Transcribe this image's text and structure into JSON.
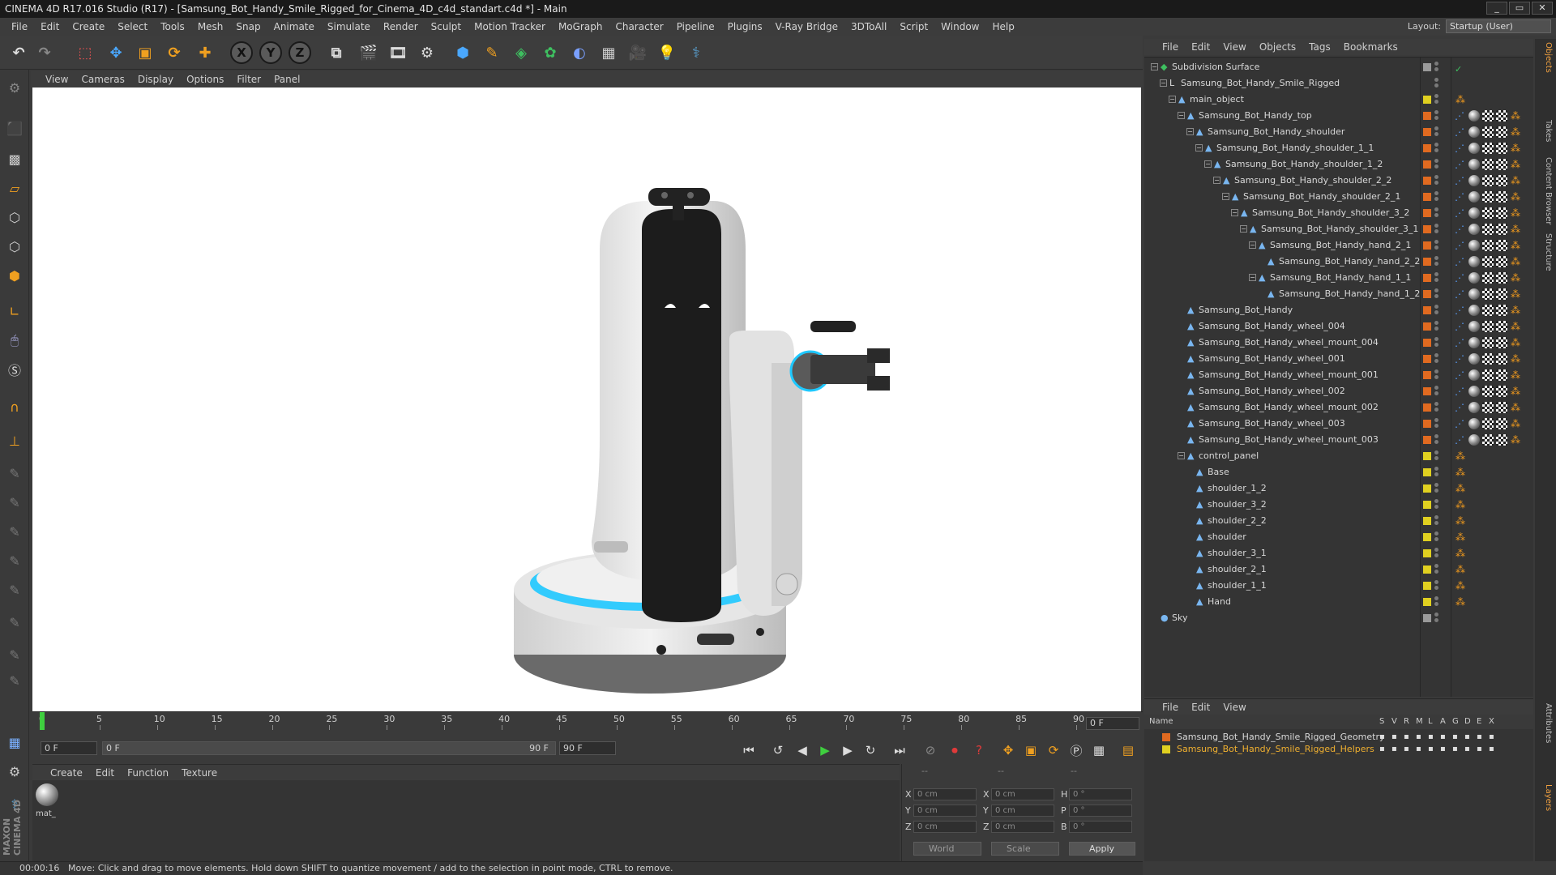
{
  "window": {
    "title": "CINEMA 4D R17.016 Studio (R17) - [Samsung_Bot_Handy_Smile_Rigged_for_Cinema_4D_c4d_standart.c4d *] - Main",
    "controls": [
      "_",
      "▭",
      "✕"
    ]
  },
  "menubar": {
    "items": [
      "File",
      "Edit",
      "Create",
      "Select",
      "Tools",
      "Mesh",
      "Snap",
      "Animate",
      "Simulate",
      "Render",
      "Sculpt",
      "Motion Tracker",
      "MoGraph",
      "Character",
      "Pipeline",
      "Plugins",
      "V-Ray Bridge",
      "3DToAll",
      "Script",
      "Window",
      "Help"
    ],
    "layout_label": "Layout:",
    "layout_value": "Startup (User)"
  },
  "toolbar": {
    "axis_x": "X",
    "axis_y": "Y",
    "axis_z": "Z"
  },
  "viewport": {
    "menu": [
      "View",
      "Cameras",
      "Display",
      "Options",
      "Filter",
      "Panel"
    ]
  },
  "timeline": {
    "ticks": [
      "0",
      "5",
      "10",
      "15",
      "20",
      "25",
      "30",
      "35",
      "40",
      "45",
      "50",
      "55",
      "60",
      "65",
      "70",
      "75",
      "80",
      "85",
      "90"
    ],
    "current_frame": "0 F"
  },
  "transport": {
    "start_frame": "0 F",
    "range_start": "0 F",
    "range_end": "90 F",
    "end_frame": "90 F"
  },
  "material_manager": {
    "menu": [
      "Create",
      "Edit",
      "Function",
      "Texture"
    ],
    "materials": [
      {
        "name": "mat_"
      }
    ]
  },
  "coordinates": {
    "header": [
      "--",
      "--",
      "--"
    ],
    "rows": [
      {
        "a": "X",
        "v1": "0 cm",
        "b": "X",
        "v2": "0 cm",
        "c": "H",
        "v3": "0 °"
      },
      {
        "a": "Y",
        "v1": "0 cm",
        "b": "Y",
        "v2": "0 cm",
        "c": "P",
        "v3": "0 °"
      },
      {
        "a": "Z",
        "v1": "0 cm",
        "b": "Z",
        "v2": "0 cm",
        "c": "B",
        "v3": "0 °"
      }
    ],
    "space": "World",
    "mode": "Scale",
    "apply": "Apply"
  },
  "statusbar": {
    "time": "00:00:16",
    "message": "Move: Click and drag to move elements. Hold down SHIFT to quantize movement / add to the selection in point mode, CTRL to remove."
  },
  "object_manager": {
    "menu": [
      "File",
      "Edit",
      "View",
      "Objects",
      "Tags",
      "Bookmarks"
    ],
    "rows": [
      {
        "name": "Subdivision Surface",
        "depth": 0,
        "color": "#9a9a9a",
        "kind": "subd"
      },
      {
        "name": "Samsung_Bot_Handy_Smile_Rigged",
        "depth": 1,
        "color": "",
        "kind": "null"
      },
      {
        "name": "main_object",
        "depth": 2,
        "color": "#e0d020",
        "kind": "bone"
      },
      {
        "name": "Samsung_Bot_Handy_top",
        "depth": 3,
        "color": "#e06a20",
        "kind": "bone"
      },
      {
        "name": "Samsung_Bot_Handy_shoulder",
        "depth": 4,
        "color": "#e06a20",
        "kind": "bone"
      },
      {
        "name": "Samsung_Bot_Handy_shoulder_1_1",
        "depth": 5,
        "color": "#e06a20",
        "kind": "bone"
      },
      {
        "name": "Samsung_Bot_Handy_shoulder_1_2",
        "depth": 6,
        "color": "#e06a20",
        "kind": "bone"
      },
      {
        "name": "Samsung_Bot_Handy_shoulder_2_2",
        "depth": 7,
        "color": "#e06a20",
        "kind": "bone"
      },
      {
        "name": "Samsung_Bot_Handy_shoulder_2_1",
        "depth": 8,
        "color": "#e06a20",
        "kind": "bone"
      },
      {
        "name": "Samsung_Bot_Handy_shoulder_3_2",
        "depth": 9,
        "color": "#e06a20",
        "kind": "bone"
      },
      {
        "name": "Samsung_Bot_Handy_shoulder_3_1",
        "depth": 10,
        "color": "#e06a20",
        "kind": "bone"
      },
      {
        "name": "Samsung_Bot_Handy_hand_2_1",
        "depth": 11,
        "color": "#e06a20",
        "kind": "bone"
      },
      {
        "name": "Samsung_Bot_Handy_hand_2_2",
        "depth": 12,
        "color": "#e06a20",
        "kind": "bone"
      },
      {
        "name": "Samsung_Bot_Handy_hand_1_1",
        "depth": 11,
        "color": "#e06a20",
        "kind": "bone"
      },
      {
        "name": "Samsung_Bot_Handy_hand_1_2",
        "depth": 12,
        "color": "#e06a20",
        "kind": "bone"
      },
      {
        "name": "Samsung_Bot_Handy",
        "depth": 3,
        "color": "#e06a20",
        "kind": "bone"
      },
      {
        "name": "Samsung_Bot_Handy_wheel_004",
        "depth": 3,
        "color": "#e06a20",
        "kind": "bone"
      },
      {
        "name": "Samsung_Bot_Handy_wheel_mount_004",
        "depth": 3,
        "color": "#e06a20",
        "kind": "bone"
      },
      {
        "name": "Samsung_Bot_Handy_wheel_001",
        "depth": 3,
        "color": "#e06a20",
        "kind": "bone"
      },
      {
        "name": "Samsung_Bot_Handy_wheel_mount_001",
        "depth": 3,
        "color": "#e06a20",
        "kind": "bone"
      },
      {
        "name": "Samsung_Bot_Handy_wheel_002",
        "depth": 3,
        "color": "#e06a20",
        "kind": "bone"
      },
      {
        "name": "Samsung_Bot_Handy_wheel_mount_002",
        "depth": 3,
        "color": "#e06a20",
        "kind": "bone"
      },
      {
        "name": "Samsung_Bot_Handy_wheel_003",
        "depth": 3,
        "color": "#e06a20",
        "kind": "bone"
      },
      {
        "name": "Samsung_Bot_Handy_wheel_mount_003",
        "depth": 3,
        "color": "#e06a20",
        "kind": "bone"
      },
      {
        "name": "control_panel",
        "depth": 3,
        "color": "#e0d020",
        "kind": "bone"
      },
      {
        "name": "Base",
        "depth": 4,
        "color": "#e0d020",
        "kind": "bone"
      },
      {
        "name": "shoulder_1_2",
        "depth": 4,
        "color": "#e0d020",
        "kind": "bone"
      },
      {
        "name": "shoulder_3_2",
        "depth": 4,
        "color": "#e0d020",
        "kind": "bone"
      },
      {
        "name": "shoulder_2_2",
        "depth": 4,
        "color": "#e0d020",
        "kind": "bone"
      },
      {
        "name": "shoulder",
        "depth": 4,
        "color": "#e0d020",
        "kind": "bone"
      },
      {
        "name": "shoulder_3_1",
        "depth": 4,
        "color": "#e0d020",
        "kind": "bone"
      },
      {
        "name": "shoulder_2_1",
        "depth": 4,
        "color": "#e0d020",
        "kind": "bone"
      },
      {
        "name": "shoulder_1_1",
        "depth": 4,
        "color": "#e0d020",
        "kind": "bone"
      },
      {
        "name": "Hand",
        "depth": 4,
        "color": "#e0d020",
        "kind": "bone"
      },
      {
        "name": "Sky",
        "depth": 0,
        "color": "#9a9a9a",
        "kind": "sky"
      }
    ]
  },
  "layer_manager": {
    "menu": [
      "File",
      "Edit",
      "View"
    ],
    "columns": [
      "Name",
      "S",
      "V",
      "R",
      "M",
      "L",
      "A",
      "G",
      "D",
      "E",
      "X"
    ],
    "layers": [
      {
        "name": "Samsung_Bot_Handy_Smile_Rigged_Geometry",
        "color": "#e06a20",
        "text_color": "#d8d8d8"
      },
      {
        "name": "Samsung_Bot_Handy_Smile_Rigged_Helpers",
        "color": "#e0d020",
        "text_color": "#f0b030"
      }
    ]
  },
  "side_tabs": [
    "Objects",
    "Takes",
    "Content Browser",
    "Structure",
    "Attributes",
    "Layers"
  ]
}
